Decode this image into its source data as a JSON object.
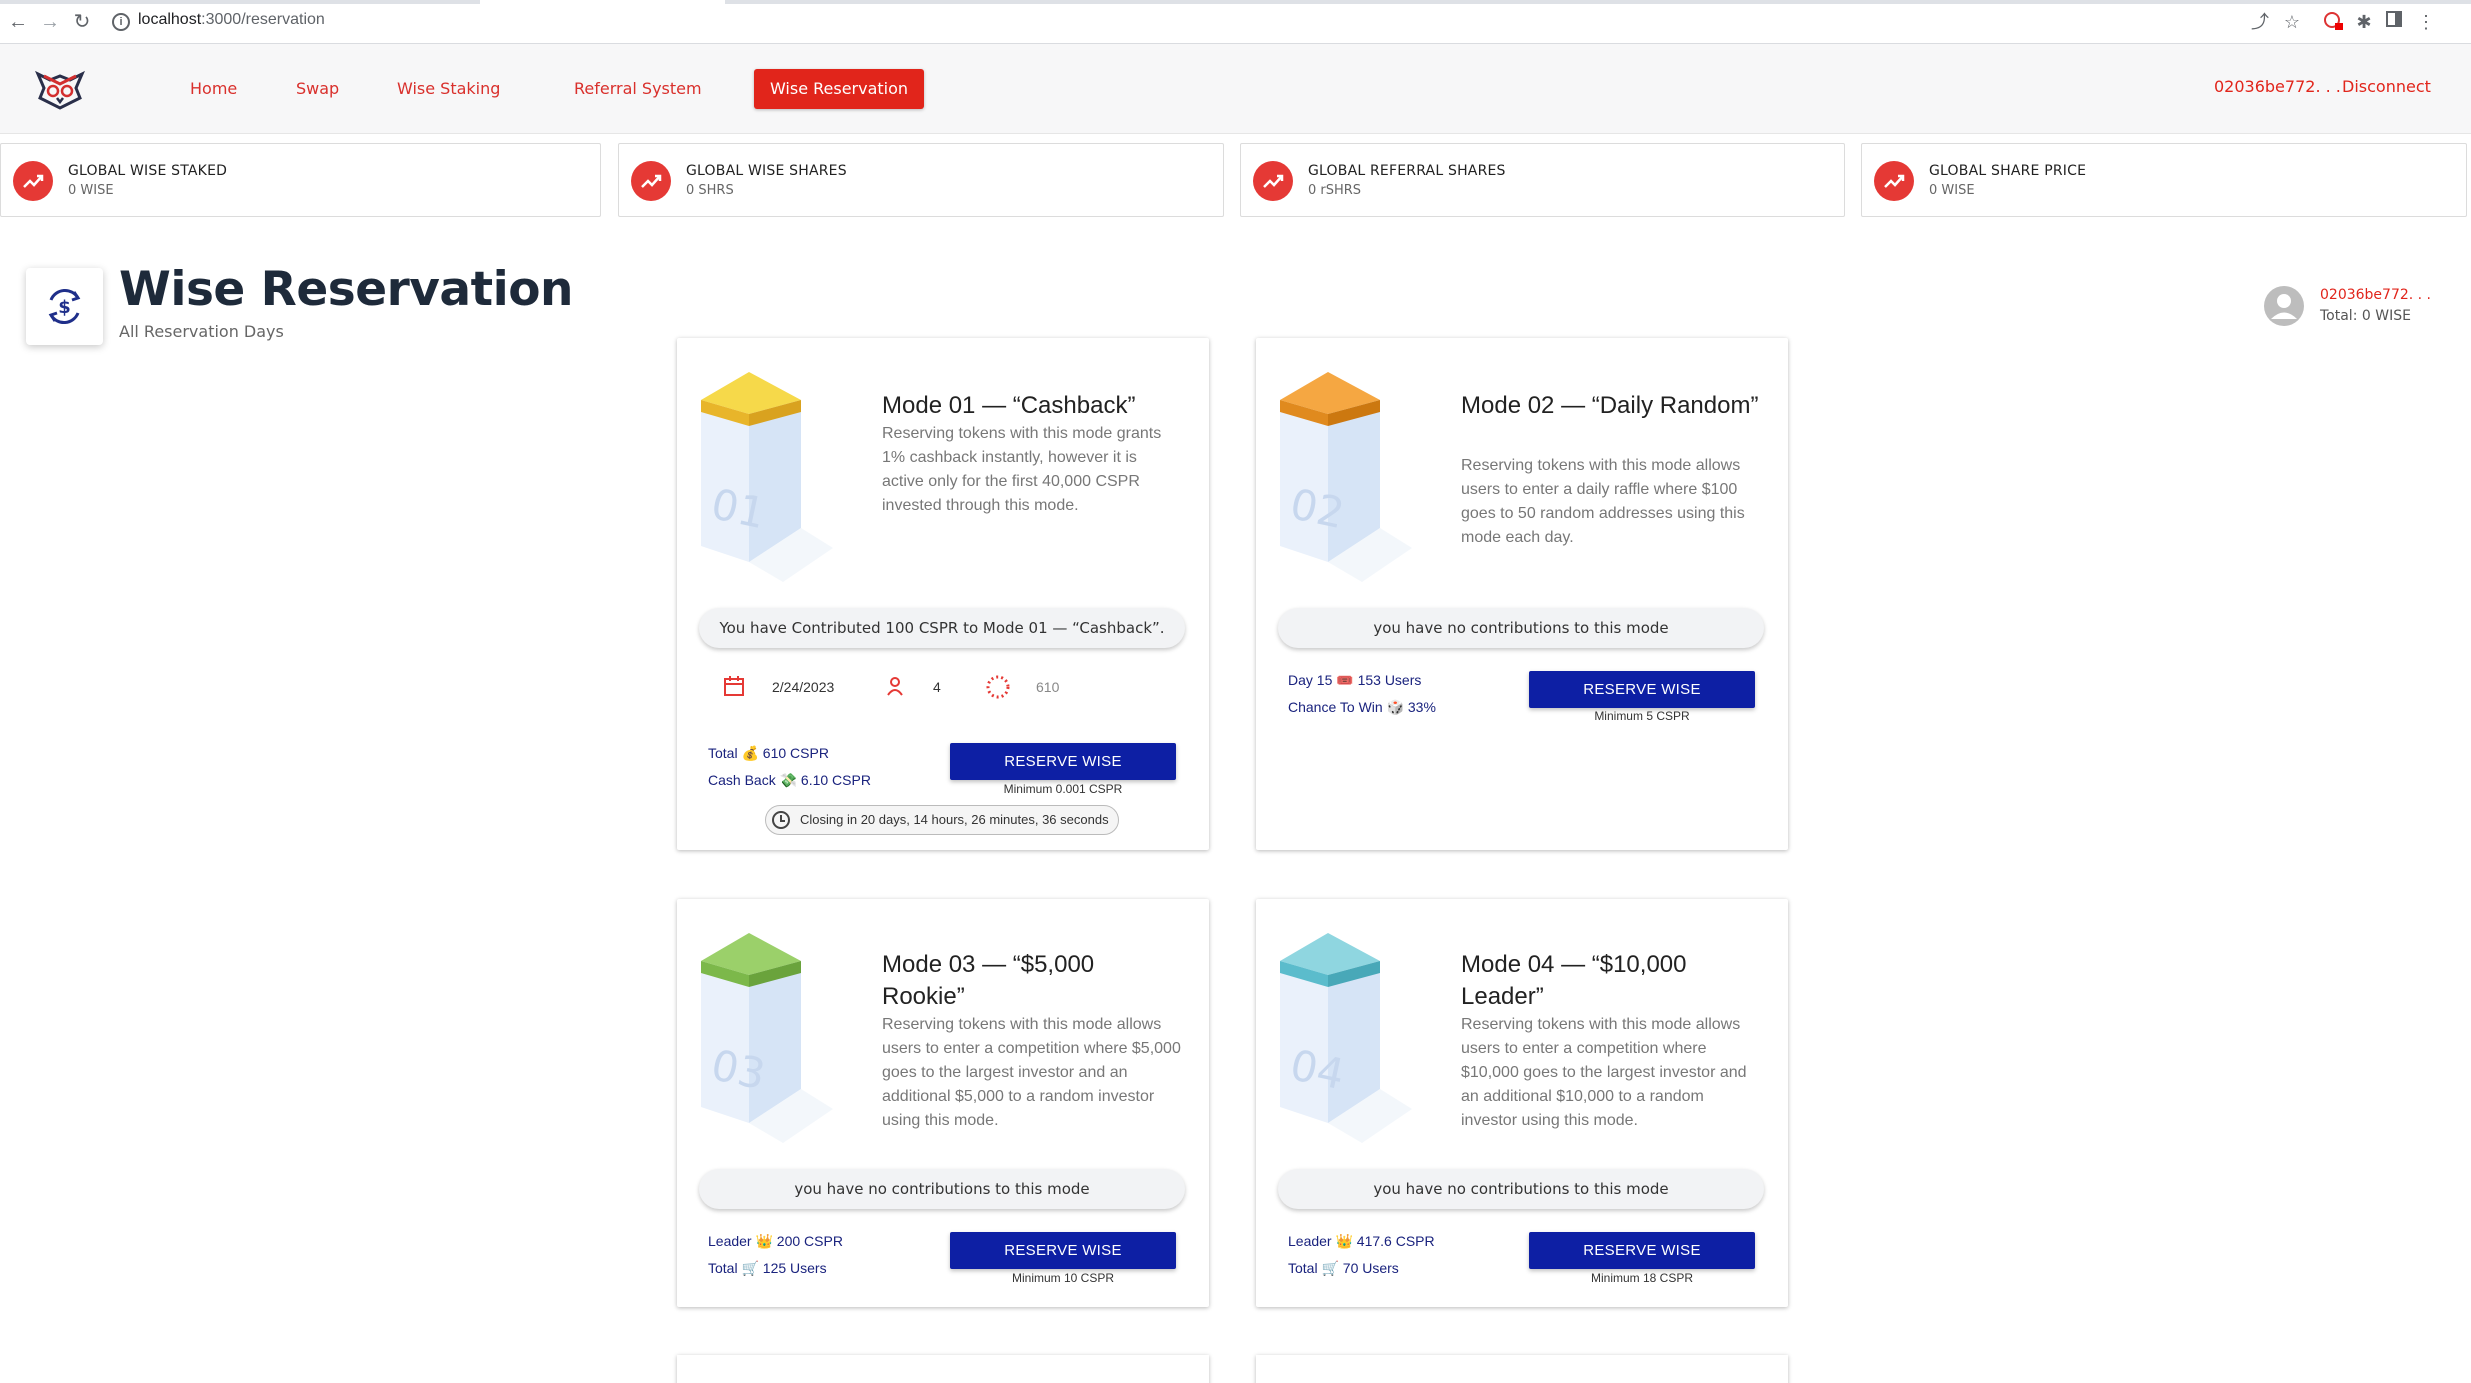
{
  "browser": {
    "url_host": "localhost",
    "url_path": ":3000/reservation"
  },
  "nav": {
    "home": "Home",
    "swap": "Swap",
    "staking": "Wise Staking",
    "referral": "Referral System",
    "reservation": "Wise Reservation",
    "address": "02036be772. . .",
    "disconnect": "Disconnect"
  },
  "stats": [
    {
      "title": "GLOBAL WISE STAKED",
      "value": "0 WISE"
    },
    {
      "title": "GLOBAL WISE SHARES",
      "value": "0 SHRS"
    },
    {
      "title": "GLOBAL REFERRAL SHARES",
      "value": "0 rSHRS"
    },
    {
      "title": "GLOBAL SHARE PRICE",
      "value": "0 WISE"
    }
  ],
  "page": {
    "title": "Wise Reservation",
    "subtitle": "All Reservation Days"
  },
  "user": {
    "address": "02036be772. . .",
    "total": "Total: 0 WISE"
  },
  "modes": [
    {
      "number": "01",
      "title": "Mode 01 — “Cashback”",
      "description": "Reserving tokens with this mode grants 1% cashback instantly, however it is active only for the first 40,000 CSPR invested through this mode.",
      "contribution": "You have Contributed 100 CSPR to Mode 01 — “Cashback”.",
      "date": "2/24/2023",
      "users": "4",
      "progress_value": "610",
      "line1": "Total 💰 610 CSPR",
      "line2": "Cash Back 💸 6.10 CSPR",
      "button": "RESERVE WISE",
      "minimum": "Minimum 0.001 CSPR",
      "closing": "Closing in 20 days, 14 hours, 26 minutes, 36 seconds",
      "color": "#f6d94a"
    },
    {
      "number": "02",
      "title": "Mode 02 — “Daily Random”",
      "description": "Reserving tokens with this mode allows users to enter a daily raffle where $100 goes to 50 random addresses using this mode each day.",
      "contribution": "you have no contributions to this mode",
      "line1": "Day 15 🎟️ 153 Users",
      "line2": "Chance To Win 🎲 33%",
      "button": "RESERVE WISE",
      "minimum": "Minimum 5 CSPR",
      "color": "#f5a742"
    },
    {
      "number": "03",
      "title": "Mode 03 — “$5,000 Rookie”",
      "description": "Reserving tokens with this mode allows users to enter a competition where $5,000 goes to the largest investor and an additional $5,000 to a random investor using this mode.",
      "contribution": "you have no contributions to this mode",
      "line1": "Leader 👑 200 CSPR",
      "line2": "Total 🛒 125 Users",
      "button": "RESERVE WISE",
      "minimum": "Minimum 10 CSPR",
      "color": "#9bd06a"
    },
    {
      "number": "04",
      "title": "Mode 04 — “$10,000 Leader”",
      "description": "Reserving tokens with this mode allows users to enter a competition where $10,000 goes to the largest investor and an additional $10,000 to a random investor using this mode.",
      "contribution": "you have no contributions to this mode",
      "line1": "Leader 👑 417.6 CSPR",
      "line2": "Total 🛒 70 Users",
      "button": "RESERVE WISE",
      "minimum": "Minimum 18 CSPR",
      "color": "#8fd6e0"
    }
  ],
  "colors": {
    "accent": "#e1251b",
    "button": "#0d1fa4",
    "link": "#1a237e"
  }
}
